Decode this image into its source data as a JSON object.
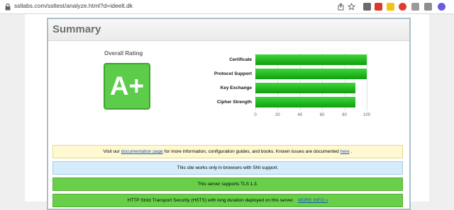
{
  "browser": {
    "url": "ssllabs.com/ssltest/analyze.html?d=ideelt.dk"
  },
  "summary": {
    "title": "Summary",
    "overall_rating_label": "Overall Rating",
    "grade": "A+"
  },
  "chart_data": {
    "type": "bar",
    "orientation": "horizontal",
    "categories": [
      "Certificate",
      "Protocol Support",
      "Key Exchange",
      "Cipher Strength"
    ],
    "values": [
      100,
      100,
      90,
      90
    ],
    "xlim": [
      0,
      100
    ],
    "xticks": [
      "0",
      "20",
      "40",
      "60",
      "80",
      "100"
    ],
    "grid": true,
    "bar_color": "#1fb61c"
  },
  "notices": {
    "doc_prefix": "Visit our",
    "doc_link": "documentation page",
    "doc_middle": "for more information, configuration guides, and books. Known issues are documented",
    "doc_here": "here",
    "doc_suffix": ".",
    "sni": "This site works only in browsers with SNI support.",
    "tls": "This server supports TLS 1.3.",
    "hsts": "HTTP Strict Transport Security (HSTS) with long duration deployed on this server.",
    "hsts_more": "MORE INFO »"
  }
}
